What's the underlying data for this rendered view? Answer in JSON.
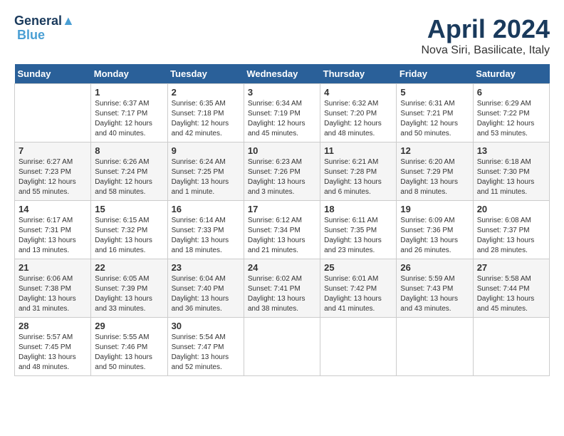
{
  "logo": {
    "line1": "General",
    "line2": "Blue"
  },
  "title": "April 2024",
  "subtitle": "Nova Siri, Basilicate, Italy",
  "days_of_week": [
    "Sunday",
    "Monday",
    "Tuesday",
    "Wednesday",
    "Thursday",
    "Friday",
    "Saturday"
  ],
  "weeks": [
    [
      {
        "num": "",
        "info": ""
      },
      {
        "num": "1",
        "info": "Sunrise: 6:37 AM\nSunset: 7:17 PM\nDaylight: 12 hours\nand 40 minutes."
      },
      {
        "num": "2",
        "info": "Sunrise: 6:35 AM\nSunset: 7:18 PM\nDaylight: 12 hours\nand 42 minutes."
      },
      {
        "num": "3",
        "info": "Sunrise: 6:34 AM\nSunset: 7:19 PM\nDaylight: 12 hours\nand 45 minutes."
      },
      {
        "num": "4",
        "info": "Sunrise: 6:32 AM\nSunset: 7:20 PM\nDaylight: 12 hours\nand 48 minutes."
      },
      {
        "num": "5",
        "info": "Sunrise: 6:31 AM\nSunset: 7:21 PM\nDaylight: 12 hours\nand 50 minutes."
      },
      {
        "num": "6",
        "info": "Sunrise: 6:29 AM\nSunset: 7:22 PM\nDaylight: 12 hours\nand 53 minutes."
      }
    ],
    [
      {
        "num": "7",
        "info": "Sunrise: 6:27 AM\nSunset: 7:23 PM\nDaylight: 12 hours\nand 55 minutes."
      },
      {
        "num": "8",
        "info": "Sunrise: 6:26 AM\nSunset: 7:24 PM\nDaylight: 12 hours\nand 58 minutes."
      },
      {
        "num": "9",
        "info": "Sunrise: 6:24 AM\nSunset: 7:25 PM\nDaylight: 13 hours\nand 1 minute."
      },
      {
        "num": "10",
        "info": "Sunrise: 6:23 AM\nSunset: 7:26 PM\nDaylight: 13 hours\nand 3 minutes."
      },
      {
        "num": "11",
        "info": "Sunrise: 6:21 AM\nSunset: 7:28 PM\nDaylight: 13 hours\nand 6 minutes."
      },
      {
        "num": "12",
        "info": "Sunrise: 6:20 AM\nSunset: 7:29 PM\nDaylight: 13 hours\nand 8 minutes."
      },
      {
        "num": "13",
        "info": "Sunrise: 6:18 AM\nSunset: 7:30 PM\nDaylight: 13 hours\nand 11 minutes."
      }
    ],
    [
      {
        "num": "14",
        "info": "Sunrise: 6:17 AM\nSunset: 7:31 PM\nDaylight: 13 hours\nand 13 minutes."
      },
      {
        "num": "15",
        "info": "Sunrise: 6:15 AM\nSunset: 7:32 PM\nDaylight: 13 hours\nand 16 minutes."
      },
      {
        "num": "16",
        "info": "Sunrise: 6:14 AM\nSunset: 7:33 PM\nDaylight: 13 hours\nand 18 minutes."
      },
      {
        "num": "17",
        "info": "Sunrise: 6:12 AM\nSunset: 7:34 PM\nDaylight: 13 hours\nand 21 minutes."
      },
      {
        "num": "18",
        "info": "Sunrise: 6:11 AM\nSunset: 7:35 PM\nDaylight: 13 hours\nand 23 minutes."
      },
      {
        "num": "19",
        "info": "Sunrise: 6:09 AM\nSunset: 7:36 PM\nDaylight: 13 hours\nand 26 minutes."
      },
      {
        "num": "20",
        "info": "Sunrise: 6:08 AM\nSunset: 7:37 PM\nDaylight: 13 hours\nand 28 minutes."
      }
    ],
    [
      {
        "num": "21",
        "info": "Sunrise: 6:06 AM\nSunset: 7:38 PM\nDaylight: 13 hours\nand 31 minutes."
      },
      {
        "num": "22",
        "info": "Sunrise: 6:05 AM\nSunset: 7:39 PM\nDaylight: 13 hours\nand 33 minutes."
      },
      {
        "num": "23",
        "info": "Sunrise: 6:04 AM\nSunset: 7:40 PM\nDaylight: 13 hours\nand 36 minutes."
      },
      {
        "num": "24",
        "info": "Sunrise: 6:02 AM\nSunset: 7:41 PM\nDaylight: 13 hours\nand 38 minutes."
      },
      {
        "num": "25",
        "info": "Sunrise: 6:01 AM\nSunset: 7:42 PM\nDaylight: 13 hours\nand 41 minutes."
      },
      {
        "num": "26",
        "info": "Sunrise: 5:59 AM\nSunset: 7:43 PM\nDaylight: 13 hours\nand 43 minutes."
      },
      {
        "num": "27",
        "info": "Sunrise: 5:58 AM\nSunset: 7:44 PM\nDaylight: 13 hours\nand 45 minutes."
      }
    ],
    [
      {
        "num": "28",
        "info": "Sunrise: 5:57 AM\nSunset: 7:45 PM\nDaylight: 13 hours\nand 48 minutes."
      },
      {
        "num": "29",
        "info": "Sunrise: 5:55 AM\nSunset: 7:46 PM\nDaylight: 13 hours\nand 50 minutes."
      },
      {
        "num": "30",
        "info": "Sunrise: 5:54 AM\nSunset: 7:47 PM\nDaylight: 13 hours\nand 52 minutes."
      },
      {
        "num": "",
        "info": ""
      },
      {
        "num": "",
        "info": ""
      },
      {
        "num": "",
        "info": ""
      },
      {
        "num": "",
        "info": ""
      }
    ]
  ]
}
